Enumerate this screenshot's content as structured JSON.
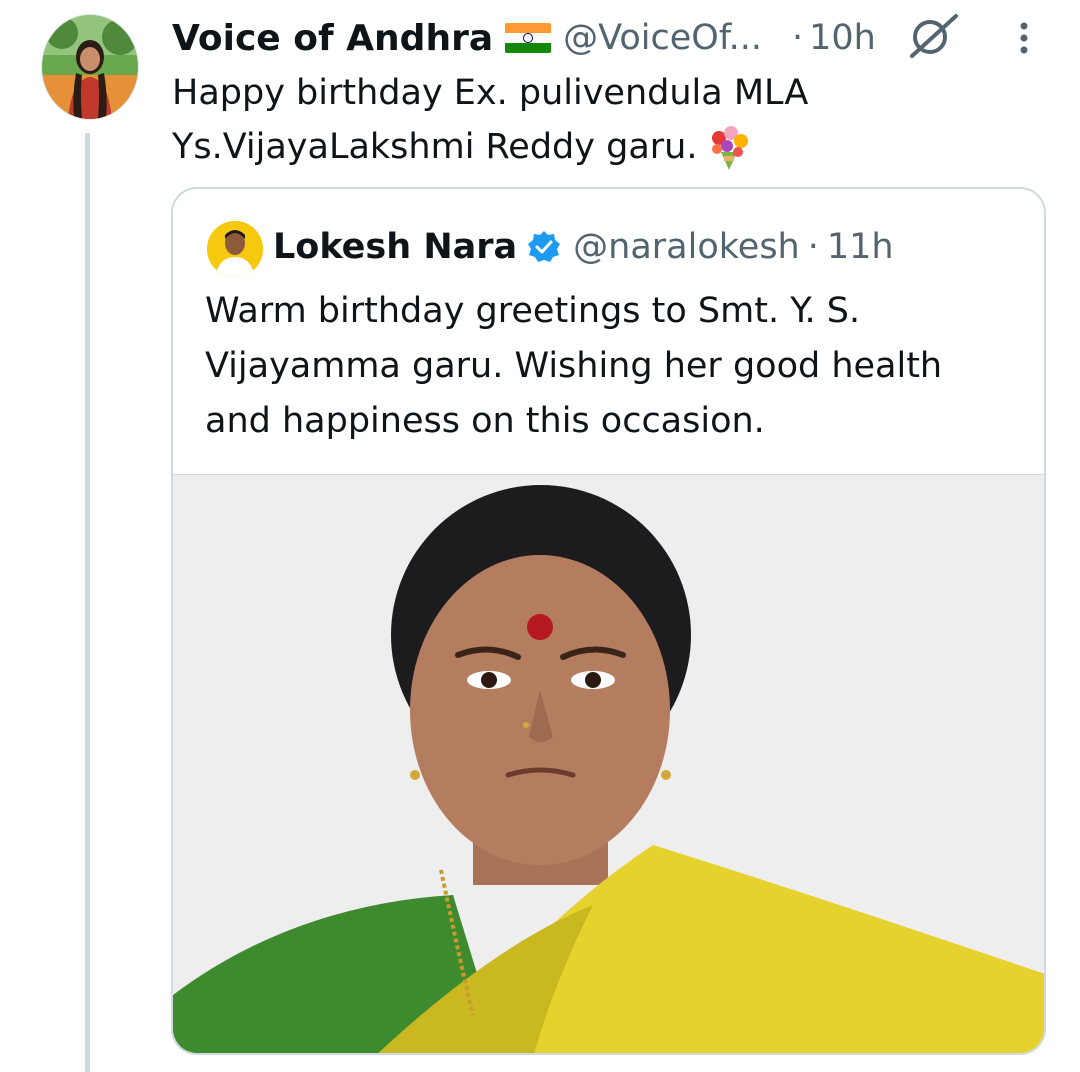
{
  "tweet": {
    "display_name": "Voice of Andhra",
    "name_emoji": "india-flag",
    "handle": "@VoiceOf...",
    "separator": "·",
    "time": "10h",
    "text_lines": [
      "Happy birthday Ex.  pulivendula MLA",
      "Ys.VijayaLakshmi Reddy garu."
    ],
    "text_emoji": "bouquet",
    "edit_icon": "edit-slash-icon",
    "more_icon": "more-vertical-icon"
  },
  "quote": {
    "display_name": "Lokesh Nara",
    "verified": true,
    "verified_color": "#1d9bf0",
    "handle": "@naralokesh",
    "separator": "·",
    "time": "11h",
    "text_lines": [
      "Warm birthday greetings to Smt. Y. S.",
      "Vijayamma garu. Wishing her good health",
      "and happiness on this occasion."
    ],
    "image_subject": "portrait photo"
  },
  "colors": {
    "primary_text": "#0f1419",
    "secondary_text": "#536471",
    "border": "#cfd9de",
    "thread_line": "#cfd9de"
  }
}
